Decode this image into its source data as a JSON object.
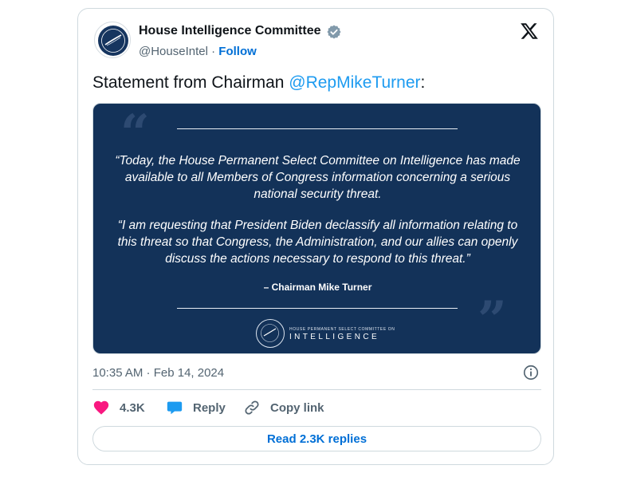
{
  "author": {
    "name": "House Intelligence Committee",
    "handle": "@HouseIntel",
    "separator": "·",
    "follow_label": "Follow"
  },
  "tweet": {
    "text_prefix": "Statement from Chairman ",
    "mention": "@RepMikeTurner",
    "text_suffix": ":"
  },
  "media": {
    "paragraph_1": "“Today, the House Permanent Select Committee on Intelligence has made available to all Members of Congress information concerning a serious national security threat.",
    "paragraph_2": "“I am requesting that President Biden declassify all information relating to this threat so that Congress, the Administration, and our allies can openly discuss the actions necessary to respond to this threat.”",
    "attribution": "– Chairman Mike Turner",
    "logo_small": "HOUSE PERMANENT SELECT COMMITTEE ON",
    "logo_big": "INTELLIGENCE",
    "quote_open": "“",
    "quote_close": "”",
    "background_color": "#133259"
  },
  "meta": {
    "timestamp": "10:35 AM · Feb 14, 2024"
  },
  "actions": {
    "likes_count": "4.3K",
    "reply_label": "Reply",
    "copy_link_label": "Copy link",
    "read_replies_label": "Read 2.3K replies"
  },
  "colors": {
    "accent": "#1d9bf0",
    "link": "#006fd6",
    "like": "#f91880",
    "muted": "#536471"
  },
  "icons": [
    "verified-badge-icon",
    "x-logo-icon",
    "info-icon",
    "heart-icon",
    "reply-bubble-icon",
    "link-icon"
  ]
}
